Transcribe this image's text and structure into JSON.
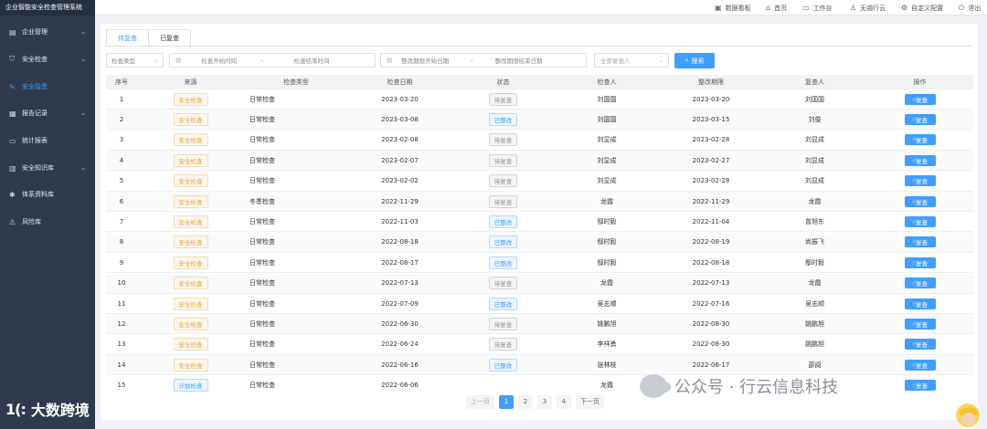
{
  "app": {
    "title": "企业智能安全检查管理系统"
  },
  "sidebar": {
    "items": [
      {
        "label": "企业管理",
        "icon": "building-icon",
        "glyph": "▤",
        "arrow": "⌄",
        "active": false
      },
      {
        "label": "安全检查",
        "icon": "user-check-icon",
        "glyph": "⛉",
        "arrow": "⌄",
        "active": false
      },
      {
        "label": "安全隐患",
        "icon": "feather-icon",
        "glyph": "✎",
        "arrow": "",
        "active": true
      },
      {
        "label": "报告记录",
        "icon": "report-icon",
        "glyph": "▦",
        "arrow": "⌄",
        "active": false
      },
      {
        "label": "统计报表",
        "icon": "folder-icon",
        "glyph": "▭",
        "arrow": "",
        "active": false
      },
      {
        "label": "安全知识库",
        "icon": "book-icon",
        "glyph": "▥",
        "arrow": "⌄",
        "active": false
      },
      {
        "label": "体系资料库",
        "icon": "gear-icon",
        "glyph": "✱",
        "arrow": "",
        "active": false
      },
      {
        "label": "风险库",
        "icon": "warning-icon",
        "glyph": "⚠",
        "arrow": "",
        "active": false
      }
    ],
    "brand": {
      "mark": "1(:",
      "text": "大数跨境"
    }
  },
  "header": {
    "items": [
      {
        "label": "数据看板",
        "icon": "dashboard-icon",
        "glyph": "▣"
      },
      {
        "label": "首页",
        "icon": "home-icon",
        "glyph": "⌂"
      },
      {
        "label": "工作台",
        "icon": "monitor-icon",
        "glyph": "▭"
      },
      {
        "label": "无锡行云",
        "icon": "user-icon",
        "glyph": "♙"
      },
      {
        "label": "自定义配置",
        "icon": "settings-icon",
        "glyph": "⚙"
      },
      {
        "label": "退出",
        "icon": "power-icon",
        "glyph": "⏻"
      }
    ]
  },
  "tabs": [
    {
      "label": "待复查",
      "active": true
    },
    {
      "label": "已复查",
      "active": false
    }
  ],
  "filters": {
    "type_placeholder": "检查类型",
    "check_start": "检查开始时间",
    "range_sep": "-",
    "check_end": "检查结束时间",
    "deadline_start": "整改期限开始日期",
    "deadline_end": "整改期限结束日期",
    "reviewer_placeholder": "全部复查人",
    "search_label": "搜索"
  },
  "table": {
    "columns": [
      "序号",
      "来源",
      "检查类型",
      "检查日期",
      "状态",
      "检查人",
      "整改期限",
      "复查人",
      "操作"
    ],
    "rows": [
      {
        "no": "1",
        "source": "安全检查",
        "source_kind": "safety",
        "type": "日常检查",
        "date": "2023-03-20",
        "status": "待复查",
        "status_kind": "pending",
        "inspector": "刘国国",
        "deadline": "2023-03-20",
        "reviewer": "刘国国",
        "op": "复查"
      },
      {
        "no": "2",
        "source": "安全检查",
        "source_kind": "safety",
        "type": "日常检查",
        "date": "2023-03-08",
        "status": "已整改",
        "status_kind": "handled",
        "inspector": "刘国国",
        "deadline": "2023-03-15",
        "reviewer": "刘俊",
        "op": "复查"
      },
      {
        "no": "3",
        "source": "安全检查",
        "source_kind": "safety",
        "type": "日常检查",
        "date": "2023-02-08",
        "status": "待复查",
        "status_kind": "pending",
        "inspector": "刘显成",
        "deadline": "2023-02-28",
        "reviewer": "刘显成",
        "op": "复查"
      },
      {
        "no": "4",
        "source": "安全检查",
        "source_kind": "safety",
        "type": "日常检查",
        "date": "2023-02-07",
        "status": "待复查",
        "status_kind": "pending",
        "inspector": "刘显成",
        "deadline": "2023-02-27",
        "reviewer": "刘显成",
        "op": "复查"
      },
      {
        "no": "5",
        "source": "安全检查",
        "source_kind": "safety",
        "type": "日常检查",
        "date": "2023-02-02",
        "status": "待复查",
        "status_kind": "pending",
        "inspector": "刘显成",
        "deadline": "2023-02-28",
        "reviewer": "刘显成",
        "op": "复查"
      },
      {
        "no": "6",
        "source": "安全检查",
        "source_kind": "safety",
        "type": "冬季检查",
        "date": "2022-11-29",
        "status": "待复查",
        "status_kind": "pending",
        "inspector": "龙霞",
        "deadline": "2022-11-29",
        "reviewer": "龙霞",
        "op": "复查"
      },
      {
        "no": "7",
        "source": "安全检查",
        "source_kind": "safety",
        "type": "日常检查",
        "date": "2022-11-03",
        "status": "已整改",
        "status_kind": "handled",
        "inspector": "鄢时毅",
        "deadline": "2022-11-04",
        "reviewer": "曾旭东",
        "op": "复查"
      },
      {
        "no": "8",
        "source": "安全检查",
        "source_kind": "safety",
        "type": "日常检查",
        "date": "2022-08-18",
        "status": "已整改",
        "status_kind": "handled",
        "inspector": "鄢时毅",
        "deadline": "2022-08-19",
        "reviewer": "尚振飞",
        "op": "复查"
      },
      {
        "no": "9",
        "source": "安全检查",
        "source_kind": "safety",
        "type": "日常检查",
        "date": "2022-08-17",
        "status": "已整改",
        "status_kind": "handled",
        "inspector": "鄢时毅",
        "deadline": "2022-08-18",
        "reviewer": "鄢时毅",
        "op": "复查"
      },
      {
        "no": "10",
        "source": "安全检查",
        "source_kind": "safety",
        "type": "日常检查",
        "date": "2022-07-13",
        "status": "待复查",
        "status_kind": "pending",
        "inspector": "龙霞",
        "deadline": "2022-07-13",
        "reviewer": "龙霞",
        "op": "复查"
      },
      {
        "no": "11",
        "source": "安全检查",
        "source_kind": "safety",
        "type": "日常检查",
        "date": "2022-07-09",
        "status": "已整改",
        "status_kind": "handled",
        "inspector": "吴志顺",
        "deadline": "2022-07-16",
        "reviewer": "吴志顺",
        "op": "复查"
      },
      {
        "no": "12",
        "source": "安全检查",
        "source_kind": "safety",
        "type": "日常检查",
        "date": "2022-06-30",
        "status": "待复查",
        "status_kind": "pending",
        "inspector": "姚鹏旭",
        "deadline": "2022-08-30",
        "reviewer": "姚鹏旭",
        "op": "复查"
      },
      {
        "no": "13",
        "source": "安全检查",
        "source_kind": "safety",
        "type": "日常检查",
        "date": "2022-06-24",
        "status": "待复查",
        "status_kind": "pending",
        "inspector": "李祥勇",
        "deadline": "2022-08-30",
        "reviewer": "姚鹏旭",
        "op": "复查"
      },
      {
        "no": "14",
        "source": "安全检查",
        "source_kind": "safety",
        "type": "日常检查",
        "date": "2022-06-16",
        "status": "已整改",
        "status_kind": "handled",
        "inspector": "张林枝",
        "deadline": "2022-06-17",
        "reviewer": "邵阅",
        "op": "复查"
      },
      {
        "no": "15",
        "source": "计划检查",
        "source_kind": "plan",
        "type": "日常检查",
        "date": "2022-06-06",
        "status": "",
        "status_kind": "",
        "inspector": "龙霞",
        "deadline": "",
        "reviewer": "",
        "op": "复查"
      }
    ]
  },
  "pagination": {
    "prev": "上一页",
    "pages": [
      "1",
      "2",
      "3",
      "4"
    ],
    "current": "1",
    "next": "下一页"
  },
  "watermark": {
    "text": "公众号 · 行云信息科技"
  }
}
